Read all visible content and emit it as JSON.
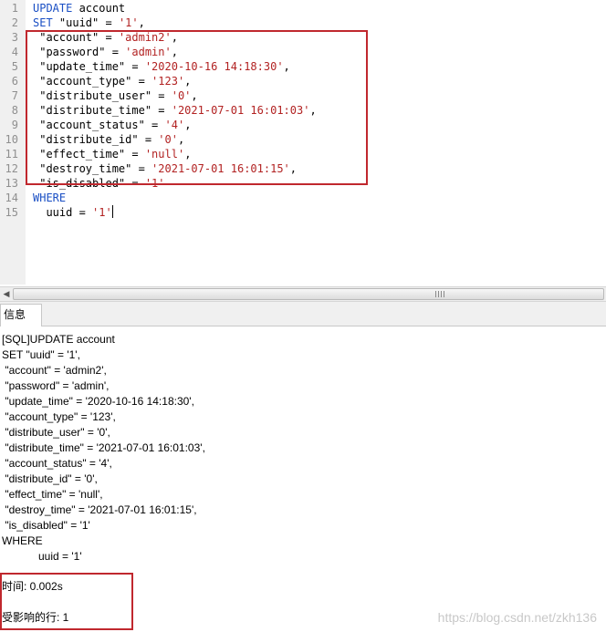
{
  "editor": {
    "lines": [
      {
        "num": "1",
        "parts": [
          {
            "t": "UPDATE",
            "c": "kw"
          },
          {
            "t": " account",
            "c": ""
          }
        ]
      },
      {
        "num": "2",
        "parts": [
          {
            "t": "SET",
            "c": "kw"
          },
          {
            "t": " \"uuid\" = ",
            "c": ""
          },
          {
            "t": "'1'",
            "c": "str"
          },
          {
            "t": ",",
            "c": ""
          }
        ]
      },
      {
        "num": "3",
        "parts": [
          {
            "t": " \"account\" = ",
            "c": ""
          },
          {
            "t": "'admin2'",
            "c": "str"
          },
          {
            "t": ",",
            "c": ""
          }
        ]
      },
      {
        "num": "4",
        "parts": [
          {
            "t": " \"password\" = ",
            "c": ""
          },
          {
            "t": "'admin'",
            "c": "str"
          },
          {
            "t": ",",
            "c": ""
          }
        ]
      },
      {
        "num": "5",
        "parts": [
          {
            "t": " \"update_time\" = ",
            "c": ""
          },
          {
            "t": "'2020-10-16 14:18:30'",
            "c": "str"
          },
          {
            "t": ",",
            "c": ""
          }
        ]
      },
      {
        "num": "6",
        "parts": [
          {
            "t": " \"account_type\" = ",
            "c": ""
          },
          {
            "t": "'123'",
            "c": "str"
          },
          {
            "t": ",",
            "c": ""
          }
        ]
      },
      {
        "num": "7",
        "parts": [
          {
            "t": " \"distribute_user\" = ",
            "c": ""
          },
          {
            "t": "'0'",
            "c": "str"
          },
          {
            "t": ",",
            "c": ""
          }
        ]
      },
      {
        "num": "8",
        "parts": [
          {
            "t": " \"distribute_time\" = ",
            "c": ""
          },
          {
            "t": "'2021-07-01 16:01:03'",
            "c": "str"
          },
          {
            "t": ",",
            "c": ""
          }
        ]
      },
      {
        "num": "9",
        "parts": [
          {
            "t": " \"account_status\" = ",
            "c": ""
          },
          {
            "t": "'4'",
            "c": "str"
          },
          {
            "t": ",",
            "c": ""
          }
        ]
      },
      {
        "num": "10",
        "parts": [
          {
            "t": " \"distribute_id\" = ",
            "c": ""
          },
          {
            "t": "'0'",
            "c": "str"
          },
          {
            "t": ",",
            "c": ""
          }
        ]
      },
      {
        "num": "11",
        "parts": [
          {
            "t": " \"effect_time\" = ",
            "c": ""
          },
          {
            "t": "'null'",
            "c": "str"
          },
          {
            "t": ",",
            "c": ""
          }
        ]
      },
      {
        "num": "12",
        "parts": [
          {
            "t": " \"destroy_time\" = ",
            "c": ""
          },
          {
            "t": "'2021-07-01 16:01:15'",
            "c": "str"
          },
          {
            "t": ",",
            "c": ""
          }
        ]
      },
      {
        "num": "13",
        "parts": [
          {
            "t": " \"is_disabled\" = ",
            "c": ""
          },
          {
            "t": "'1'",
            "c": "str"
          }
        ]
      },
      {
        "num": "14",
        "parts": [
          {
            "t": "WHERE",
            "c": "kw"
          }
        ]
      },
      {
        "num": "15",
        "parts": [
          {
            "t": "  uuid = ",
            "c": ""
          },
          {
            "t": "'1'",
            "c": "str"
          }
        ],
        "caret": true
      }
    ]
  },
  "result": {
    "tab_label": "信息",
    "messages": [
      "[SQL]UPDATE account",
      "SET \"uuid\" = '1',",
      " \"account\" = 'admin2',",
      " \"password\" = 'admin',",
      " \"update_time\" = '2020-10-16 14:18:30',",
      " \"account_type\" = '123',",
      " \"distribute_user\" = '0',",
      " \"distribute_time\" = '2021-07-01 16:01:03',",
      " \"account_status\" = '4',",
      " \"distribute_id\" = '0',",
      " \"effect_time\" = 'null',",
      " \"destroy_time\" = '2021-07-01 16:01:15',",
      " \"is_disabled\" = '1'",
      "WHERE",
      "            uuid = '1'"
    ],
    "time_label": "时间: 0.002s",
    "rows_label": "受影响的行: 1"
  },
  "watermark": "https://blog.csdn.net/zkh136",
  "colors": {
    "keyword": "#1a4fc4",
    "string": "#b22222",
    "highlight_border": "#c0282e"
  },
  "icons": {
    "scroll_left": "triangle-left-icon",
    "scroll_grip": "grip-icon"
  }
}
